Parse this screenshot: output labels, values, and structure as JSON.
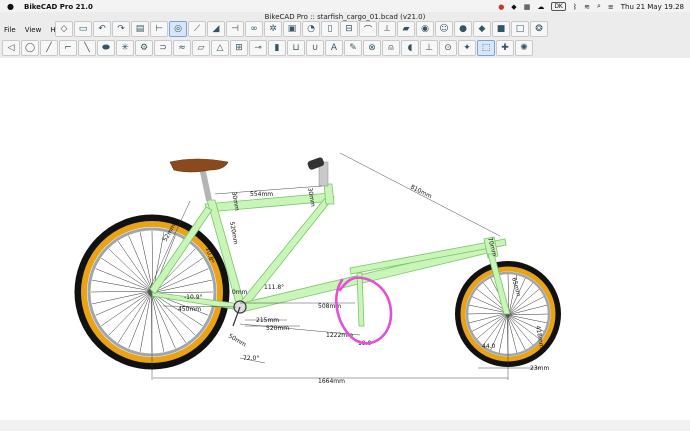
{
  "menubar": {
    "apple_icon": "apple-icon",
    "app_name": "BikeCAD Pro 21.0",
    "input_source": "DK",
    "datetime": "Thu 21 May  19.28"
  },
  "window": {
    "title": "BikeCAD Pro :: starfish_cargo_01.bcad (v21.0)"
  },
  "menu": {
    "file": "File",
    "view": "View",
    "help": "Help"
  },
  "toolbar_row1": [
    {
      "icon": "frame-icon",
      "glyph": "◇"
    },
    {
      "icon": "tube-icon",
      "glyph": "▭"
    },
    {
      "icon": "undo-icon",
      "glyph": "↶"
    },
    {
      "icon": "redo-icon",
      "glyph": "↷"
    },
    {
      "icon": "ruler-icon",
      "glyph": "▤"
    },
    {
      "icon": "dimension-icon",
      "glyph": "⊢"
    },
    {
      "icon": "wheel-icon",
      "glyph": "◎"
    },
    {
      "icon": "fork-icon",
      "glyph": "⟋"
    },
    {
      "icon": "saddle-icon",
      "glyph": "◢"
    },
    {
      "icon": "stem-icon",
      "glyph": "⊣"
    },
    {
      "icon": "chain-icon",
      "glyph": "∞"
    },
    {
      "icon": "gear-icon",
      "glyph": "✲"
    },
    {
      "icon": "bag-icon",
      "glyph": "▣"
    },
    {
      "icon": "light-icon",
      "glyph": "◔"
    },
    {
      "icon": "bottle-icon",
      "glyph": "▯"
    },
    {
      "icon": "rack-icon",
      "glyph": "⊟"
    },
    {
      "icon": "fender-icon",
      "glyph": "⌒"
    },
    {
      "icon": "kickstand-icon",
      "glyph": "⟂"
    },
    {
      "icon": "flag-icon",
      "glyph": "▰"
    },
    {
      "icon": "gauge-icon",
      "glyph": "◉"
    },
    {
      "icon": "person-icon",
      "glyph": "☺"
    },
    {
      "icon": "color-wheel-icon",
      "glyph": "●"
    },
    {
      "icon": "palette-icon",
      "glyph": "◆"
    },
    {
      "icon": "black-square-icon",
      "glyph": "■"
    },
    {
      "icon": "white-square-icon",
      "glyph": "□"
    },
    {
      "icon": "globe-icon",
      "glyph": "❂"
    }
  ],
  "toolbar_row2": [
    {
      "icon": "frame-outline-icon",
      "glyph": "◁"
    },
    {
      "icon": "wheel-outline-icon",
      "glyph": "◯"
    },
    {
      "icon": "seatpost-icon",
      "glyph": "╱"
    },
    {
      "icon": "pedal-icon",
      "glyph": "⌐"
    },
    {
      "icon": "crank-icon",
      "glyph": "╲"
    },
    {
      "icon": "tire-icon",
      "glyph": "⬬"
    },
    {
      "icon": "hub-icon",
      "glyph": "✳"
    },
    {
      "icon": "derailleur-icon",
      "glyph": "⚙"
    },
    {
      "icon": "brake-icon",
      "glyph": "⊃"
    },
    {
      "icon": "cable-icon",
      "glyph": "≈"
    },
    {
      "icon": "tube-set-icon",
      "glyph": "▱"
    },
    {
      "icon": "triangle-icon",
      "glyph": "△"
    },
    {
      "icon": "headset-icon",
      "glyph": "⊞"
    },
    {
      "icon": "shifter-icon",
      "glyph": "⊸"
    },
    {
      "icon": "grip-icon",
      "glyph": "▮"
    },
    {
      "icon": "basket-icon",
      "glyph": "⊔"
    },
    {
      "icon": "dropout-icon",
      "glyph": "∪"
    },
    {
      "icon": "text-tool-icon",
      "glyph": "A"
    },
    {
      "icon": "wrench-icon",
      "glyph": "✎"
    },
    {
      "icon": "lock-icon",
      "glyph": "⊗"
    },
    {
      "icon": "bell-icon",
      "glyph": "⍝"
    },
    {
      "icon": "mirror-icon",
      "glyph": "◖"
    },
    {
      "icon": "pump-icon",
      "glyph": "⊥"
    },
    {
      "icon": "bearing-icon",
      "glyph": "⊙"
    },
    {
      "icon": "spoke-icon",
      "glyph": "✦"
    },
    {
      "icon": "frame-select-icon",
      "glyph": "⬚"
    },
    {
      "icon": "plus-icon",
      "glyph": "✚"
    },
    {
      "icon": "wheel-blue-icon",
      "glyph": "✺"
    }
  ],
  "dimensions": {
    "d810": "810mm",
    "d554": "554mm",
    "d30a": "30mm",
    "d30b": "30mm",
    "d520v": "520mm",
    "d52": "52mm",
    "d108": "10.8°",
    "d1118": "111.8°",
    "d0mm": "0mm",
    "d10_9": "-10.9°",
    "d450": "450mm",
    "d215": "215mm",
    "d520": "520mm",
    "d508": "508mm",
    "d1222": "1222mm",
    "d50": "50mm",
    "d720": "72.0°",
    "d1664": "1664mm",
    "d19": "19.0",
    "d70": "70mm",
    "d65": "65mm",
    "d418": "418mm",
    "d44": "44.0",
    "d23": "23mm"
  },
  "colors": {
    "frame_fill": "#c9f5b8",
    "frame_stroke": "#7cc46a",
    "tire": "#111111",
    "tire_tread": "#e8a317",
    "rim": "#9ea7b0",
    "saddle": "#8b4a1c",
    "annotation": "#e34fd8"
  }
}
